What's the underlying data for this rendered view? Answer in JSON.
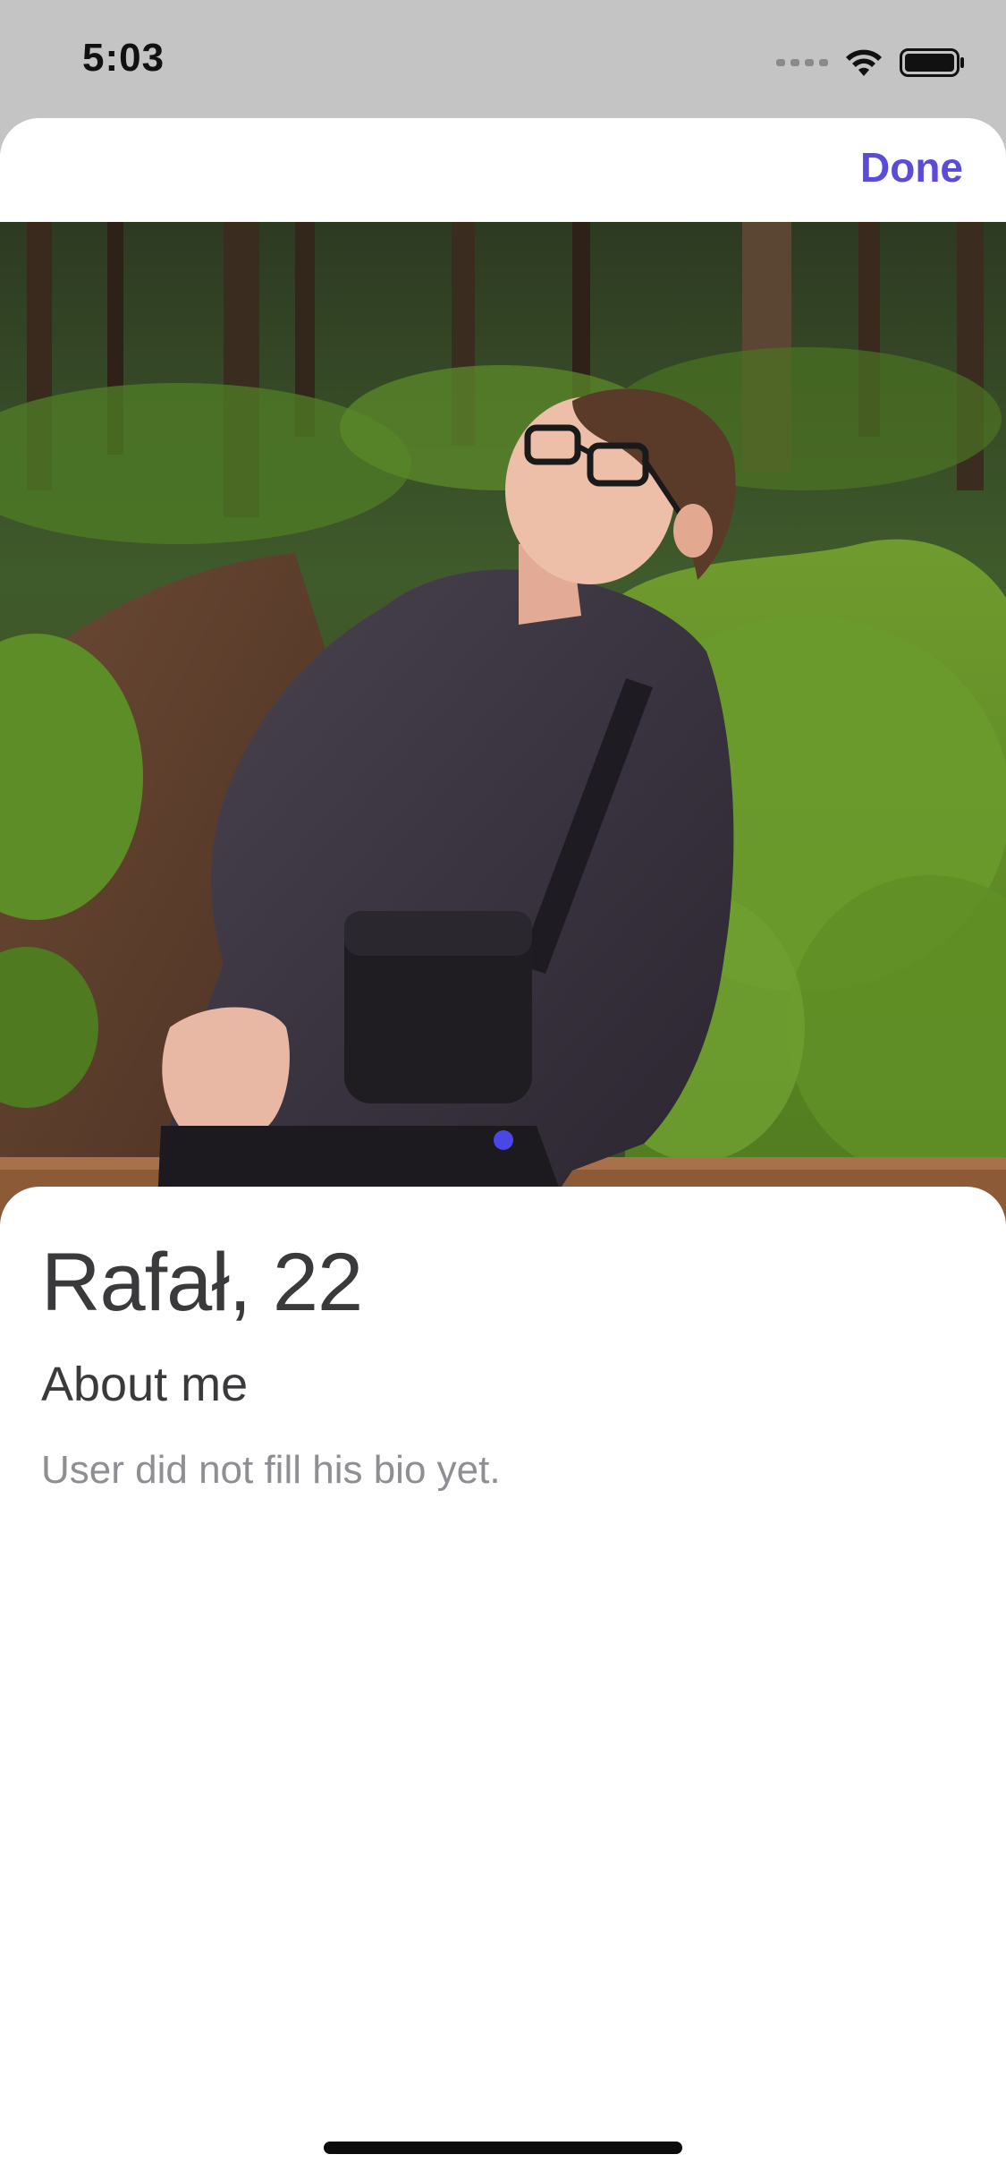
{
  "status_bar": {
    "time": "5:03"
  },
  "header": {
    "done_label": "Done"
  },
  "photo": {
    "description": "profile-photo",
    "page_count": 1,
    "current_page": 1
  },
  "profile": {
    "name_age": "Rafał, 22",
    "about_title": "About me",
    "bio": "User did not fill his bio yet."
  },
  "colors": {
    "accent": "#5b4bdb",
    "page_dot": "#4b46e6",
    "title_text": "#3a3a3c",
    "secondary_text": "#8e8e93"
  }
}
